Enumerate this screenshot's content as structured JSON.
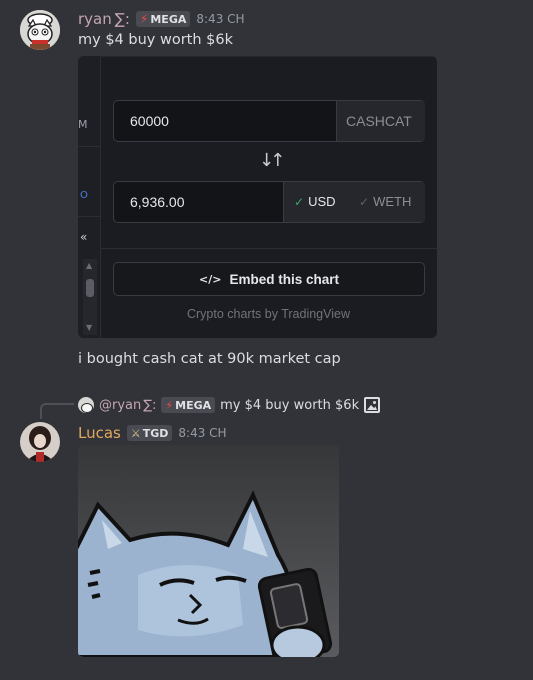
{
  "msg1": {
    "username": "ryan",
    "username_suffix": "∑:",
    "badge": "MEGA",
    "time": "8:43 CH",
    "text": "my $4 buy worth $6k"
  },
  "embed": {
    "sidebar_label_a": "M",
    "sidebar_label_b": "O",
    "from_value": "60000",
    "from_token": "CASHCAT",
    "to_value": "6,936.00",
    "usd_label": "USD",
    "weth_label": "WETH",
    "embed_button": "Embed this chart",
    "footer": "Crypto charts by TradingView"
  },
  "msg2": {
    "text": "i bought cash cat at 90k market cap"
  },
  "reply": {
    "mention": "@ryan",
    "mention_suffix": "∑:",
    "badge": "MEGA",
    "text": "my $4 buy worth $6k"
  },
  "msg3": {
    "username": "Lucas",
    "badge": "TGD",
    "time": "8:43 CH"
  },
  "colors": {
    "background": "#323339",
    "ryan_name": "#c4a6b0",
    "lucas_name": "#e0a85e",
    "check_green": "#3fa36b",
    "embed_bg": "#1b1c21"
  }
}
